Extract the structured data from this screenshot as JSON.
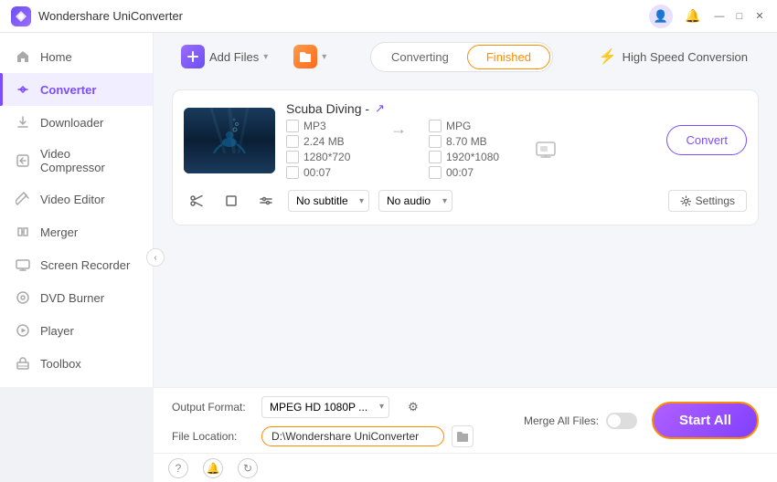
{
  "titlebar": {
    "logo_alt": "Wondershare UniConverter logo",
    "title": "Wondershare UniConverter",
    "user_icon": "👤",
    "bell_icon": "🔔",
    "minimize": "—",
    "maximize": "□",
    "close": "✕"
  },
  "sidebar": {
    "items": [
      {
        "id": "home",
        "label": "Home",
        "icon": "🏠",
        "active": false
      },
      {
        "id": "converter",
        "label": "Converter",
        "icon": "🔄",
        "active": true
      },
      {
        "id": "downloader",
        "label": "Downloader",
        "icon": "⬇️",
        "active": false
      },
      {
        "id": "video-compressor",
        "label": "Video Compressor",
        "icon": "📦",
        "active": false
      },
      {
        "id": "video-editor",
        "label": "Video Editor",
        "icon": "✂️",
        "active": false
      },
      {
        "id": "merger",
        "label": "Merger",
        "icon": "🔀",
        "active": false
      },
      {
        "id": "screen-recorder",
        "label": "Screen Recorder",
        "icon": "🖥️",
        "active": false
      },
      {
        "id": "dvd-burner",
        "label": "DVD Burner",
        "icon": "💿",
        "active": false
      },
      {
        "id": "player",
        "label": "Player",
        "icon": "▶️",
        "active": false
      },
      {
        "id": "toolbox",
        "label": "Toolbox",
        "icon": "🧰",
        "active": false
      }
    ]
  },
  "toolbar": {
    "add_files_label": "Add Files",
    "add_btn_icon": "+",
    "converting_tab": "Converting",
    "finished_tab": "Finished",
    "speed_conversion": "High Speed Conversion"
  },
  "file_card": {
    "title": "Scuba Diving -",
    "edit_icon": "✏️",
    "source": {
      "format": "MP3",
      "format_icon": "☐",
      "size": "2.24 MB",
      "size_icon": "☐",
      "resolution": "1280*720",
      "resolution_icon": "☐",
      "duration": "00:07",
      "duration_icon": "☐"
    },
    "target": {
      "format": "MPG",
      "format_icon": "☐",
      "size": "8.70 MB",
      "size_icon": "☐",
      "resolution": "1920*1080",
      "resolution_icon": "☐",
      "duration": "00:07",
      "duration_icon": "☐"
    },
    "subtitle_label": "No subtitle",
    "audio_label": "No audio",
    "settings_label": "Settings",
    "convert_btn": "Convert"
  },
  "bottom": {
    "output_format_label": "Output Format:",
    "output_format_value": "MPEG HD 1080P ...",
    "file_location_label": "File Location:",
    "file_location_value": "D:\\Wondershare UniConverter",
    "merge_label": "Merge All Files:",
    "start_all_label": "Start All"
  },
  "statusbar": {
    "help_icon": "?",
    "notification_icon": "🔔",
    "refresh_icon": "↻"
  }
}
